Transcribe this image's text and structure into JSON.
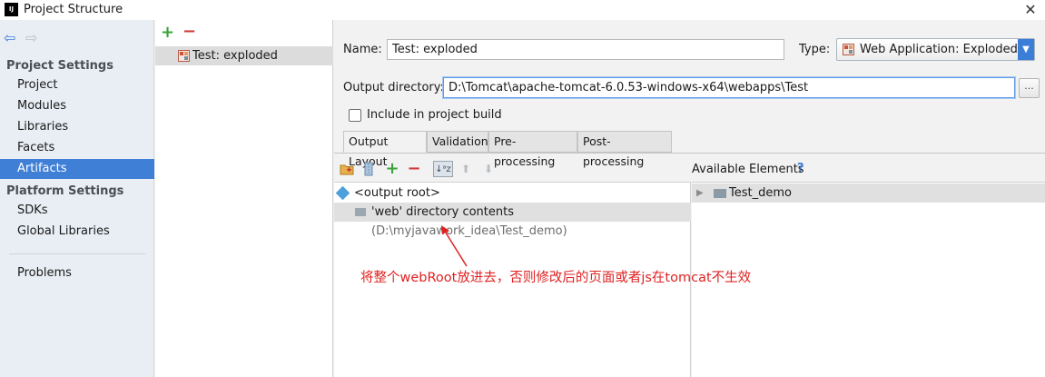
{
  "window": {
    "app_icon_text": "IJ",
    "title": "Project Structure",
    "close_glyph": "✕"
  },
  "nav": {
    "back_glyph": "⇦",
    "forward_glyph": "⇨",
    "project_settings_header": "Project Settings",
    "project_settings_items": [
      {
        "label": "Project"
      },
      {
        "label": "Modules"
      },
      {
        "label": "Libraries"
      },
      {
        "label": "Facets"
      },
      {
        "label": "Artifacts",
        "selected": true
      }
    ],
    "platform_settings_header": "Platform Settings",
    "platform_settings_items": [
      {
        "label": "SDKs"
      },
      {
        "label": "Global Libraries"
      }
    ],
    "problems_label": "Problems"
  },
  "artifacts": {
    "add_glyph": "+",
    "remove_glyph": "−",
    "items": [
      {
        "label": "Test: exploded",
        "icon": "web-artifact-icon"
      }
    ]
  },
  "form": {
    "name_label": "Name:",
    "name_value": "Test: exploded",
    "type_label": "Type:",
    "type_value": "Web Application: Exploded",
    "type_arrow": "▼",
    "output_label": "Output directory:",
    "output_value": "D:\\Tomcat\\apache-tomcat-6.0.53-windows-x64\\webapps\\Test",
    "browse_label": "...",
    "include_label": "Include in project build",
    "include_checked": false
  },
  "tabs": [
    {
      "label": "Output Layout",
      "active": true
    },
    {
      "label": "Validation"
    },
    {
      "label": "Pre-processing"
    },
    {
      "label": "Post-processing"
    }
  ],
  "layout_toolbar": {
    "icons": [
      "new-folder-icon",
      "archive-icon",
      "add-icon",
      "remove-icon",
      "sort-icon",
      "move-up-icon",
      "move-down-icon"
    ],
    "add_glyph": "+",
    "remove_glyph": "−",
    "sort_glyph": "↓ᵃz",
    "up_glyph": "⬆",
    "down_glyph": "⬇"
  },
  "layout_tree": {
    "root_label": "<output root>",
    "child_label": "'web' directory contents",
    "child_path": "(D:\\myjavawork_idea\\Test_demo)"
  },
  "available": {
    "label": "Available Elements",
    "help": "?",
    "items": [
      {
        "label": "Test_demo",
        "expand_glyph": "▶"
      }
    ]
  },
  "annotation": {
    "text": "将整个webRoot放进去，否则修改后的页面或者js在tomcat不生效",
    "color": "#e02222"
  },
  "colors": {
    "selection": "#3f7fd6",
    "accent": "#3b7ed8"
  }
}
